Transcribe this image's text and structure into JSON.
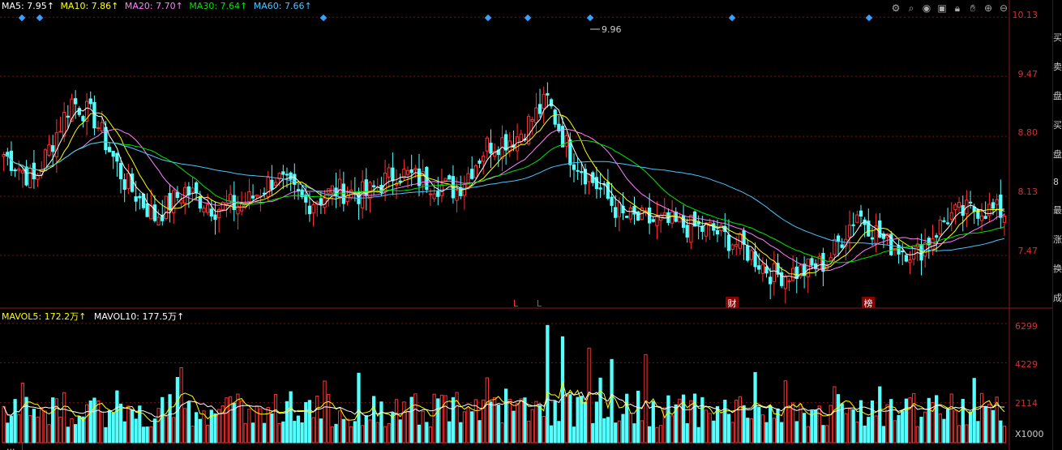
{
  "ma_legend": {
    "ma5": "MA5: 7.95↑",
    "ma10": "MA10: 7.86↑",
    "ma20": "MA20: 7.70↑",
    "ma30": "MA30: 7.64↑",
    "ma60": "MA60: 7.66↑"
  },
  "vol_legend": {
    "mavol5": "MAVOL5: 172.2万↑",
    "mavol10": "MAVOL10: 177.5万↑"
  },
  "price_axis": [
    "10.13",
    "9.47",
    "8.80",
    "8.13",
    "7.47"
  ],
  "volume_axis": [
    "6299",
    "4229",
    "2114"
  ],
  "volume_unit": "X1000",
  "high_marker": "9.96",
  "event_markers": [
    "L",
    "L",
    "财",
    "榜"
  ],
  "toolbar_icons": [
    "settings-icon",
    "search-icon",
    "eye-icon",
    "box-icon",
    "lock-icon",
    "hand-icon",
    "zoom-in-icon",
    "zoom-out-icon"
  ],
  "tabs": [
    "..."
  ],
  "side_panel": [
    "买",
    "卖",
    "盘",
    "买",
    "盘",
    "8",
    "最",
    "涨",
    "换",
    "成"
  ],
  "colors": {
    "up": "#ff3232",
    "down": "#54ffff",
    "ma5": "#ffffff",
    "ma10": "#ffff00",
    "ma20": "#ff80ff",
    "ma30": "#00e600",
    "ma60": "#4cc4ff",
    "grid": "#7a1010"
  },
  "chart_data": {
    "type": "candlestick",
    "y_ticks": [
      10.13,
      9.47,
      8.8,
      8.13,
      7.47
    ],
    "volume_ticks": [
      6299,
      4229,
      2114
    ],
    "ylim": [
      6.9,
      10.25
    ],
    "vol_max": 6600
  }
}
